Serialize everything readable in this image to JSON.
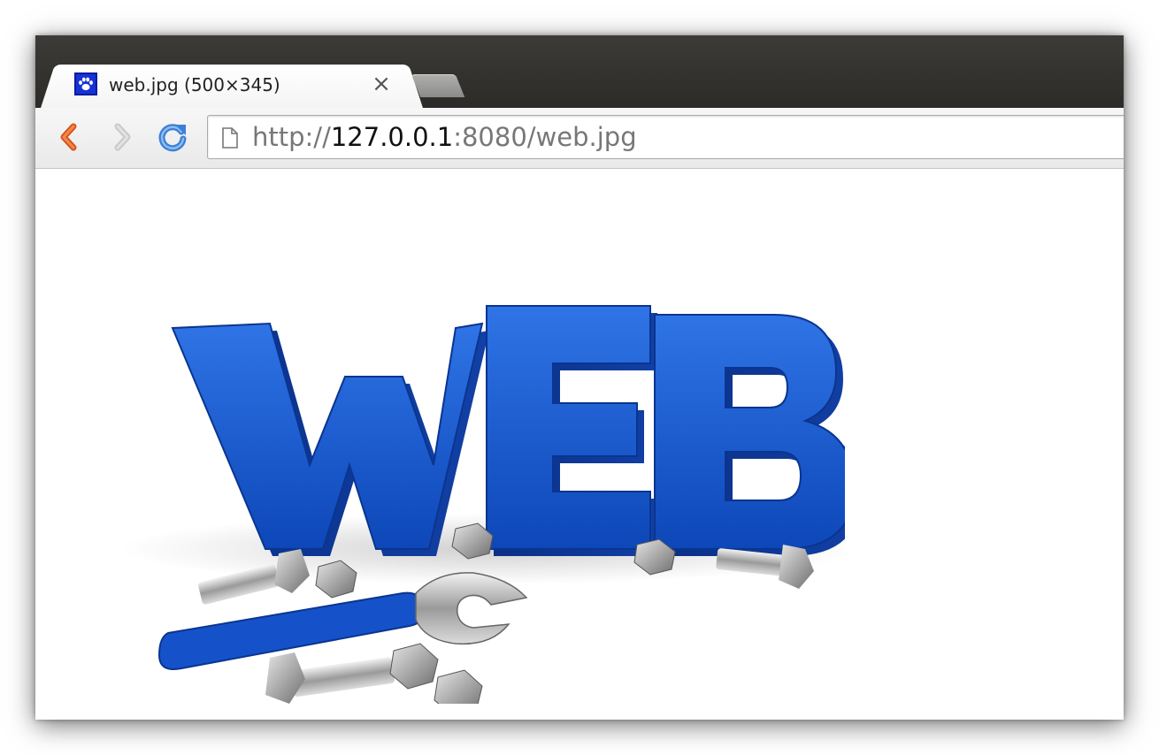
{
  "browser": {
    "tab": {
      "title": "web.jpg (500×345)",
      "favicon_icon": "paw-icon",
      "close_label": "×"
    },
    "toolbar": {
      "back_icon": "back-arrow-icon",
      "forward_icon": "forward-arrow-icon",
      "reload_icon": "reload-icon"
    },
    "omnibox": {
      "icon": "page-icon",
      "scheme": "http://",
      "host": "127.0.0.1",
      "rest": ":8080/web.jpg"
    }
  },
  "page": {
    "image_text": "WEB",
    "colors": {
      "accent_blue": "#1552c9",
      "back_orange": "#d9531e",
      "reload_blue": "#3b7fd6"
    }
  }
}
